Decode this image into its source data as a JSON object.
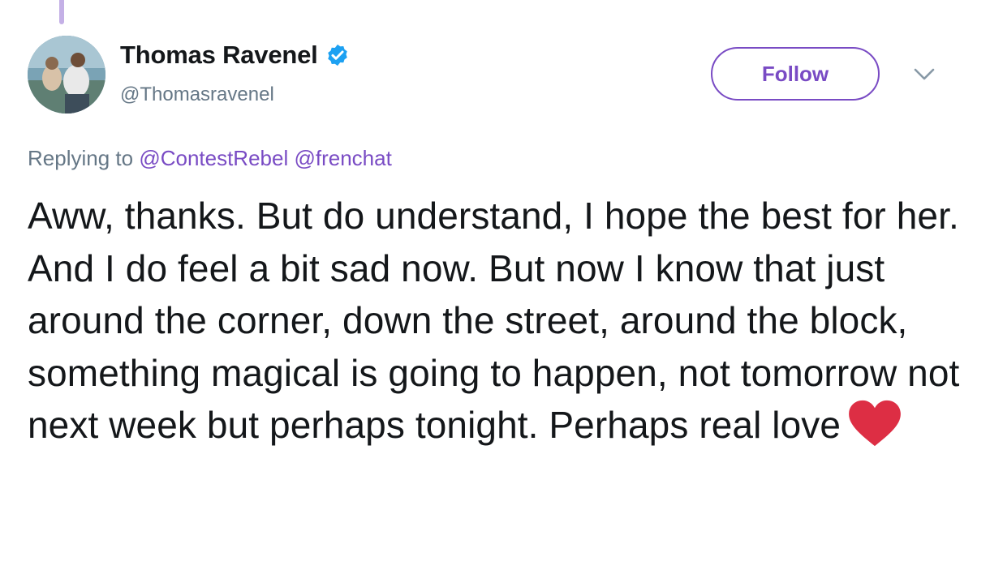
{
  "author": {
    "display_name": "Thomas Ravenel",
    "handle": "@Thomasravenel",
    "verified": true,
    "avatar_icon": "profile-photo"
  },
  "follow_button": {
    "label": "Follow"
  },
  "menu": {
    "icon": "chevron-down-icon"
  },
  "reply": {
    "prefix": "Replying to",
    "mentions": [
      "@ContestRebel",
      "@frenchat"
    ]
  },
  "tweet": {
    "text": "Aww, thanks. But do understand, I hope the best for her. And I do feel a bit sad now. But now I know that just around the corner, down the street, around the block, something magical is going to happen, not tomorrow not next week but perhaps tonight. Perhaps real love",
    "emoji": "red-heart-icon"
  },
  "colors": {
    "accent": "#794bc4",
    "muted": "#657786",
    "text": "#14171a",
    "verified": "#1da1f2",
    "heart": "#dd2e44"
  }
}
